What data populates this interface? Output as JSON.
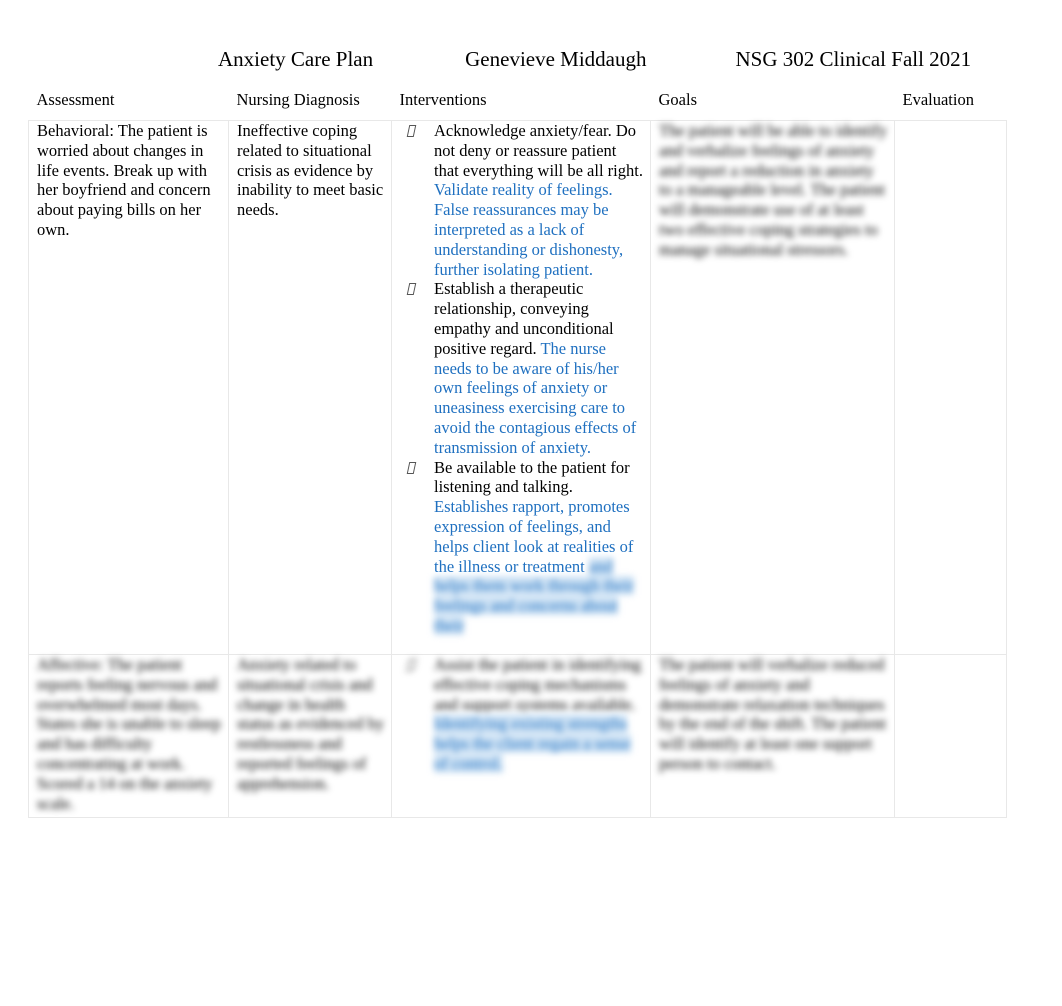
{
  "header": {
    "title": "Anxiety Care Plan",
    "author": "Genevieve Middaugh",
    "course": "NSG 302 Clinical Fall 2021"
  },
  "table": {
    "columns": [
      {
        "key": "assessment",
        "label": "Assessment"
      },
      {
        "key": "diagnosis",
        "label": "Nursing Diagnosis"
      },
      {
        "key": "interventions",
        "label": "Interventions"
      },
      {
        "key": "goals",
        "label": "Goals"
      },
      {
        "key": "evaluation",
        "label": "Evaluation"
      }
    ],
    "rows": [
      {
        "assessment": "Behavioral: The patient is worried about changes in life events.  Break up with her boyfriend and concern about paying bills on her own.",
        "diagnosis": "Ineffective coping related to situational crisis as evidence by inability to meet basic needs.",
        "interventions": [
          {
            "action": "Acknowledge anxiety/fear. Do not deny or reassure patient that everything will be all right. ",
            "rationale": " Validate reality of feelings.  False reassurances may be interpreted as a lack of understanding or dishonesty, further isolating patient."
          },
          {
            "action": "Establish a therapeutic relationship, conveying empathy and unconditional positive regard. ",
            "rationale": " The nurse needs to be aware of his/her own feelings of anxiety or uneasiness exercising care to avoid the contagious effects of transmission of anxiety."
          },
          {
            "action": "Be available to the patient for listening and talking.",
            "rationale": "Establishes rapport, promotes expression of feelings, and helps client look at realities of the illness or treatment",
            "selected_tail": "and helps them work through their feelings and concerns about their"
          }
        ],
        "goals": "The patient will be able to identify and verbalize feelings of anxiety and report a reduction in anxiety to a manageable level. The patient will demonstrate use of at least two effective coping strategies to manage situational stressors.",
        "evaluation": ""
      },
      {
        "assessment": "Affective: The patient reports feeling nervous and overwhelmed most days. States she is unable to sleep and has difficulty concentrating at work.  Scored a 14 on the anxiety scale.",
        "diagnosis": "Anxiety related to situational crisis and change in health status as evidenced by restlessness and reported feelings of apprehension.",
        "interventions": [
          {
            "action": "Assist the patient in identifying effective coping mechanisms and support systems available. ",
            "rationale": "",
            "selected_tail": "Identifying existing strengths helps the client regain a sense of control."
          }
        ],
        "goals": "The patient will verbalize reduced feelings of anxiety and demonstrate relaxation techniques by the end of the shift. The patient will identify at least one support person to contact.",
        "evaluation": ""
      }
    ]
  },
  "colors": {
    "rationale_blue": "#1f70c0",
    "selection_highlight": "#cfe3f5",
    "table_border": "#e8e8e8",
    "text": "#000000"
  },
  "icons": {
    "bullet": "wingding-bullet-missing-glyph"
  }
}
